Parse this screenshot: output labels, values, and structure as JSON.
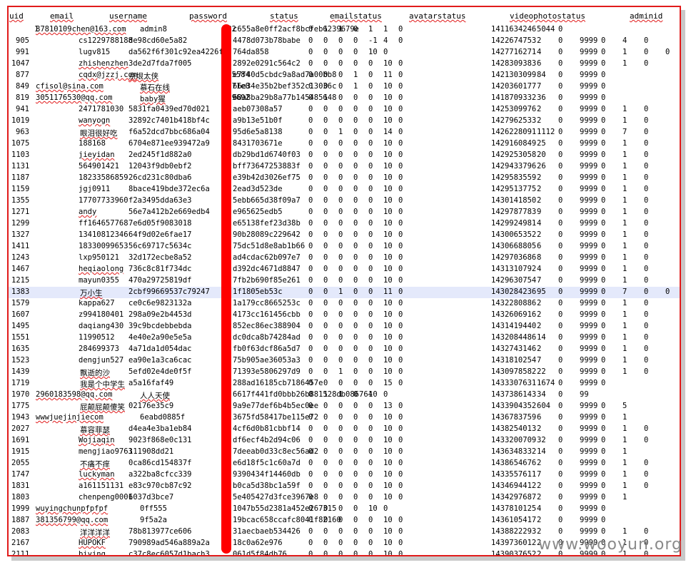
{
  "headers": [
    "uid",
    "email",
    "username",
    "password",
    "status",
    "emailstatus",
    "avatarstatus",
    "videophotostatus",
    "adminid"
  ],
  "rows": [
    [
      "1",
      "87810109chen@163.com",
      "admin8",
      "582",
      "c655a8e0ff2acf8bcfeb6239679e",
      "0",
      "1",
      "1",
      "0",
      "1",
      "1",
      "0",
      "1411634246",
      "5044",
      "0"
    ],
    [
      "905",
      "cs1229788188",
      "de98cd60e5a82",
      "",
      "4478d073b78babe",
      "0",
      "0",
      "0",
      "0",
      "-1",
      "4",
      "0",
      "1422674753",
      "2",
      "0",
      "9999",
      "0",
      "4",
      "0"
    ],
    [
      "991",
      "lugv815",
      "da562f6f301c92ea4226f0",
      "",
      "764da858",
      "0",
      "0",
      "0",
      "0",
      "10",
      "0",
      "1427716271",
      "4",
      "0",
      "9999",
      "0",
      "1",
      "0",
      "0"
    ],
    [
      "1047",
      "zhishenzhen",
      "3de2d7fda7f005",
      "",
      "2892e0291c564c2",
      "0",
      "0",
      "0",
      "0",
      "0",
      "10",
      "0",
      "1428309383",
      "6",
      "0",
      "9999",
      "0",
      "1",
      "0"
    ],
    [
      "877",
      "cqdx@jzzj.com",
      "京垠太侠",
      "2c5584",
      "e7f40d5cbdc9a8ad7a00bb8",
      "0",
      "0",
      "0",
      "1",
      "0",
      "11",
      "0",
      "1421303099",
      "84",
      "0",
      "9999",
      "0"
    ],
    [
      "849",
      "cfisol@sina.com",
      "慕石在线",
      "b171e8",
      "66e34e35b2bef352c13036c",
      "0",
      "0",
      "0",
      "1",
      "0",
      "10",
      "0",
      "1420360177",
      "7",
      "0",
      "9999",
      "0"
    ],
    [
      "819",
      "3051176530@qq.com",
      "baby猩",
      "d19692",
      "68a8ba29b8a77b145485648",
      "0",
      "1",
      "0",
      "0",
      "0",
      "10",
      "0",
      "1418709332",
      "36",
      "0",
      "9999",
      "0"
    ],
    [
      "941",
      "2471781030",
      "5831fa0439ed70d021",
      "",
      "aeb07308a57",
      "0",
      "0",
      "0",
      "0",
      "0",
      "10",
      "0",
      "1425309976",
      "2",
      "0",
      "9999",
      "0",
      "1",
      "0"
    ],
    [
      "1019",
      "wanyogn",
      "32892c7401b418bf4c",
      "",
      "a9b13e51b0f",
      "0",
      "0",
      "0",
      "0",
      "0",
      "10",
      "0",
      "1427962533",
      "2",
      "0",
      "9999",
      "0",
      "1",
      "0"
    ],
    [
      "963",
      "眼泪很好吃",
      "f6a52dcd7bbc686a04",
      "",
      "95d6e5a8138",
      "0",
      "0",
      "1",
      "0",
      "0",
      "14",
      "0",
      "1426228091",
      "1112",
      "0",
      "9999",
      "0",
      "7",
      "0"
    ],
    [
      "1075",
      "188168",
      "6704e871ee939472a9",
      "",
      "8431703671e",
      "0",
      "0",
      "0",
      "0",
      "0",
      "10",
      "0",
      "1429160849",
      "25",
      "0",
      "9999",
      "0",
      "1",
      "0"
    ],
    [
      "1103",
      "jieyidan",
      "2ed245f1d882a0",
      "",
      "db29bd1d6740f03",
      "0",
      "0",
      "0",
      "0",
      "0",
      "10",
      "0",
      "1429253058",
      "20",
      "0",
      "9999",
      "0",
      "1",
      "0"
    ],
    [
      "1131",
      "564901421",
      "12043f9db0ebf2",
      "",
      "bff73647253883f",
      "0",
      "0",
      "0",
      "0",
      "0",
      "10",
      "0",
      "1429433796",
      "26",
      "0",
      "9999",
      "0",
      "1",
      "0"
    ],
    [
      "1187",
      "18233586859",
      "26cd231c80dba6",
      "",
      "e39b42d3026ef75",
      "0",
      "0",
      "0",
      "0",
      "0",
      "10",
      "0",
      "1429583559",
      "2",
      "0",
      "9999",
      "0",
      "1",
      "0"
    ],
    [
      "1159",
      "jgj0911",
      "8bace419bde372ec6a",
      "",
      "2ead3d523de",
      "0",
      "0",
      "0",
      "0",
      "0",
      "10",
      "0",
      "1429513775",
      "2",
      "0",
      "9999",
      "0",
      "1",
      "0"
    ],
    [
      "1355",
      "17707733960",
      "f2a3495dda63e3",
      "",
      "5ebb665d38f09a7",
      "0",
      "0",
      "0",
      "0",
      "0",
      "10",
      "0",
      "1430141850",
      "2",
      "0",
      "9999",
      "0",
      "1",
      "0"
    ],
    [
      "1271",
      "andy",
      "56e7a412b2e669edb4",
      "",
      "e965625edb5",
      "0",
      "0",
      "0",
      "0",
      "0",
      "10",
      "0",
      "1429787783",
      "9",
      "0",
      "9999",
      "0",
      "1",
      "0"
    ],
    [
      "1299",
      "ff164657768",
      "7e6d05f9083018",
      "",
      "e65138fef23d38b",
      "0",
      "0",
      "0",
      "0",
      "0",
      "10",
      "0",
      "1429924981",
      "4",
      "0",
      "9999",
      "0",
      "1",
      "0"
    ],
    [
      "1327",
      "13410812346",
      "64f9d02e6fae17",
      "",
      "90b28089c229642",
      "0",
      "0",
      "0",
      "0",
      "0",
      "10",
      "0",
      "1430065352",
      "2",
      "0",
      "9999",
      "0",
      "1",
      "0"
    ],
    [
      "1411",
      "18330099653",
      "56c69717c5634c",
      "",
      "75dc51d8e8ab1b66",
      "0",
      "0",
      "0",
      "0",
      "0",
      "10",
      "0",
      "1430668805",
      "6",
      "0",
      "9999",
      "0",
      "1",
      "0"
    ],
    [
      "1243",
      "lxp950121",
      "32d172ecbe8a52",
      "",
      "ad4cdac62b097e7",
      "0",
      "0",
      "0",
      "0",
      "0",
      "10",
      "0",
      "1429703686",
      "8",
      "0",
      "9999",
      "0",
      "1",
      "0"
    ],
    [
      "1467",
      "heqiaolong",
      "736c8c81f734dc",
      "",
      "d392dc4671d8847",
      "0",
      "0",
      "0",
      "0",
      "0",
      "10",
      "0",
      "1431310792",
      "4",
      "0",
      "9999",
      "0",
      "1",
      "0"
    ],
    [
      "1215",
      "mayun0355",
      "470a29725819df",
      "",
      "7fb2b690f85e261",
      "0",
      "0",
      "0",
      "0",
      "0",
      "10",
      "0",
      "1429630754",
      "7",
      "0",
      "9999",
      "0",
      "1",
      "0"
    ],
    [
      "1383",
      "万小生",
      "2cbf99669537c79247",
      "",
      "1f1805eb53c",
      "0",
      "0",
      "1",
      "0",
      "0",
      "11",
      "0",
      "1430284236",
      "95",
      "0",
      "9999",
      "0",
      "7",
      "0",
      "0"
    ],
    [
      "1579",
      "kappa627",
      "ce0c6e9823132a",
      "",
      "1a179cc8665253c",
      "0",
      "0",
      "0",
      "0",
      "0",
      "10",
      "0",
      "1432280886",
      "2",
      "0",
      "9999",
      "0",
      "1",
      "0"
    ],
    [
      "1607",
      "z994180401",
      "298a09e2b4453d",
      "",
      "4173cc161456cbb",
      "0",
      "0",
      "0",
      "0",
      "0",
      "10",
      "0",
      "1432606916",
      "2",
      "0",
      "9999",
      "0",
      "1",
      "0"
    ],
    [
      "1495",
      "daqiang430",
      "39c9bcdebbebda",
      "",
      "852ec86ec388904",
      "0",
      "0",
      "0",
      "0",
      "0",
      "10",
      "0",
      "1431419440",
      "2",
      "0",
      "9999",
      "0",
      "1",
      "0"
    ],
    [
      "1551",
      "11990512",
      "4e40e2a90e5e5a",
      "",
      "dc0dca8b74284ad",
      "0",
      "0",
      "0",
      "0",
      "0",
      "10",
      "0",
      "1432084486",
      "14",
      "0",
      "9999",
      "0",
      "1",
      "0"
    ],
    [
      "1635",
      "284699373",
      "4a71da1d054dac",
      "",
      "fb0f63dcf86a5d7",
      "0",
      "0",
      "0",
      "0",
      "0",
      "10",
      "0",
      "1432743146",
      "2",
      "0",
      "9999",
      "0",
      "1",
      "0"
    ],
    [
      "1523",
      "dengjun527",
      "ea90e1a3ca6cac",
      "",
      "75b905ae36053a3",
      "0",
      "0",
      "0",
      "0",
      "0",
      "10",
      "0",
      "1431810254",
      "7",
      "0",
      "9999",
      "0",
      "1",
      "0"
    ],
    [
      "1439",
      "飘逝的沙",
      "5efd02e4de0f5f",
      "",
      "71393e5806297d9",
      "0",
      "0",
      "1",
      "0",
      "0",
      "10",
      "0",
      "1430978582",
      "22",
      "0",
      "9999",
      "0",
      "1",
      "0"
    ],
    [
      "1719",
      "我是个中学生",
      "a5a16faf49",
      "",
      "288ad16185cb7186457e",
      "0",
      "0",
      "0",
      "0",
      "0",
      "15",
      "0",
      "1433307631",
      "1674",
      "0",
      "9999",
      "0"
    ],
    [
      "1970",
      "2960183598@qq.com",
      "人人天使",
      "",
      "6617f441fd0bbb26b881528db086764",
      "0",
      "1",
      "1",
      "0",
      "10",
      "0",
      "1437386143",
      "34",
      "0",
      "99"
    ],
    [
      "1775",
      "屁颠屁颠傻笑",
      "02176e35c9",
      "",
      "9a9e77def6b4b5ec0ee",
      "0",
      "0",
      "0",
      "0",
      "0",
      "13",
      "0",
      "1433904352",
      "604",
      "0",
      "9999",
      "0",
      "5"
    ],
    [
      "1943",
      "wwwjuejinjiecom",
      "6eabd0885f",
      "",
      "3675fd58417be115e72",
      "0",
      "0",
      "0",
      "0",
      "0",
      "10",
      "0",
      "1436783759",
      "6",
      "0",
      "9999",
      "0",
      "1"
    ],
    [
      "2027",
      "慕容菲瑟",
      "d4ea4e3ba1eb84",
      "",
      "4cf6d0b81cbbf14",
      "0",
      "0",
      "0",
      "0",
      "0",
      "10",
      "0",
      "1438254013",
      "2",
      "0",
      "9999",
      "0",
      "1",
      "0"
    ],
    [
      "1691",
      "Wojiaqin",
      "9023f868e0c131",
      "",
      "df6ecf4b2d94c06",
      "0",
      "0",
      "0",
      "0",
      "0",
      "10",
      "0",
      "1433200709",
      "32",
      "0",
      "9999",
      "0",
      "1",
      "0"
    ],
    [
      "1915",
      "mengjiao9763",
      "111908dd21",
      "",
      "7deeab0d33c8ec56ad2",
      "0",
      "0",
      "0",
      "0",
      "0",
      "10",
      "0",
      "1436348332",
      "14",
      "0",
      "9999",
      "0",
      "1"
    ],
    [
      "2055",
      "不痛不痒",
      "0ca86cd154837f",
      "",
      "e6d18f5c1c60a7d",
      "0",
      "0",
      "0",
      "0",
      "0",
      "10",
      "0",
      "1438654676",
      "2",
      "0",
      "9999",
      "0",
      "1",
      "0"
    ],
    [
      "1747",
      "luckyman",
      "a322ba8cfcc339",
      "",
      "9390434f14460db",
      "0",
      "0",
      "0",
      "0",
      "0",
      "10",
      "0",
      "1433557611",
      "7",
      "0",
      "9999",
      "0",
      "1",
      "0"
    ],
    [
      "1831",
      "a161151131",
      "e83c970cb87c92",
      "",
      "b0ca5d38bc1a59f",
      "0",
      "0",
      "0",
      "0",
      "0",
      "10",
      "0",
      "1434694412",
      "2",
      "0",
      "9999",
      "0",
      "1",
      "0"
    ],
    [
      "1803",
      "chenpeng0001",
      "6037d3bce7",
      "",
      "5e405427d3fce3967e8",
      "0",
      "0",
      "0",
      "0",
      "0",
      "10",
      "0",
      "1434297687",
      "2",
      "0",
      "9999",
      "0",
      "1"
    ],
    [
      "1999",
      "wuyingchunpfpfpf",
      "0ff555",
      "",
      "1047b55d2381a452e267315",
      "0",
      "0",
      "0",
      "0",
      "10",
      "0",
      "1437810125",
      "4",
      "0",
      "9999",
      "0"
    ],
    [
      "1887",
      "381356799@qq.com",
      "9f5a2a",
      "",
      "19bcac658ccafc8041f82160",
      "0",
      "0",
      "0",
      "0",
      "0",
      "10",
      "0",
      "1436105417",
      "2",
      "0",
      "9999",
      "0"
    ],
    [
      "2083",
      "洋洋洋洋",
      "78b813977ce606",
      "",
      "31aecbaeb534426",
      "0",
      "0",
      "0",
      "0",
      "0",
      "10",
      "0",
      "1438822293",
      "2",
      "0",
      "9999",
      "0",
      "1",
      "0"
    ],
    [
      "2167",
      "HUPOKF",
      "790989ad546a889a2a",
      "",
      "18c0a62e976",
      "0",
      "0",
      "0",
      "0",
      "0",
      "10",
      "0",
      "1439736012",
      "2",
      "0",
      "9999",
      "0",
      "1",
      "0"
    ],
    [
      "2111",
      "biying",
      "c37c8ec6057d1bach3",
      "",
      "061d5f84db76",
      "0",
      "0",
      "0",
      "0",
      "0",
      "10",
      "0",
      "1439037652",
      "2",
      "0",
      "9999",
      "0",
      "1",
      "0"
    ]
  ],
  "watermark": "www.wooyun.org"
}
